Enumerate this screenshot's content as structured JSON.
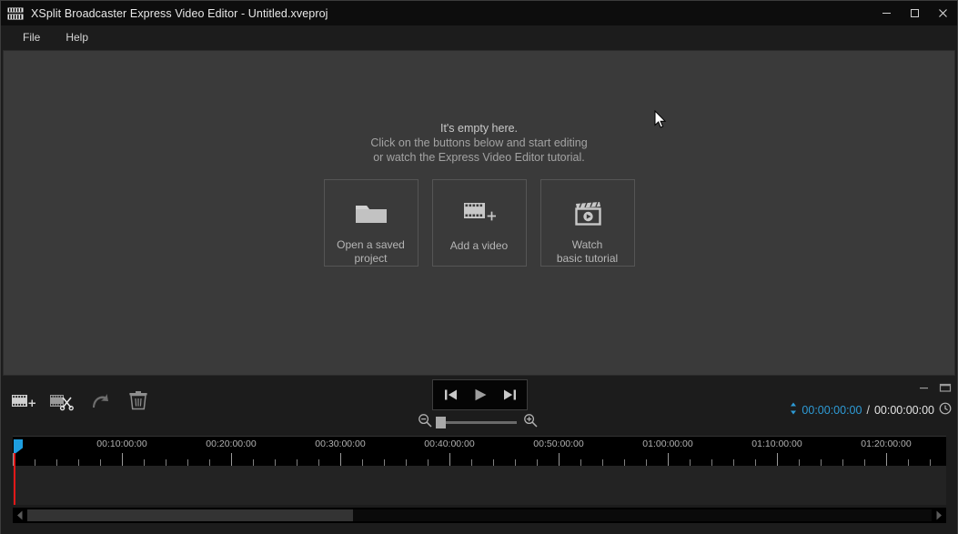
{
  "window": {
    "title": "XSplit Broadcaster Express Video Editor - Untitled.xveproj",
    "app_icon": "clapperboard-icon",
    "controls": [
      {
        "name": "minimize-button",
        "glyph": "minimize-icon"
      },
      {
        "name": "maximize-button",
        "glyph": "maximize-icon"
      },
      {
        "name": "close-button",
        "glyph": "close-icon"
      }
    ]
  },
  "menubar": {
    "items": [
      {
        "label": "File"
      },
      {
        "label": "Help"
      }
    ]
  },
  "preview": {
    "empty_state": {
      "line1": "It's empty here.",
      "line2": "Click on the buttons below and start editing",
      "line3": "or watch the Express Video Editor tutorial."
    },
    "actions": [
      {
        "label": "Open a saved\nproject",
        "icon": "folder-icon",
        "name": "open-saved-project-button"
      },
      {
        "label": "Add a video",
        "icon": "film-plus-icon",
        "name": "add-a-video-button"
      },
      {
        "label": "Watch\nbasic tutorial",
        "icon": "clapperboard-play-icon",
        "name": "watch-basic-tutorial-button"
      }
    ]
  },
  "toolbar": {
    "buttons": [
      {
        "name": "add-media-button",
        "icon": "film-plus-icon"
      },
      {
        "name": "split-clip-button",
        "icon": "film-scissors-icon"
      },
      {
        "name": "undo-button",
        "icon": "undo-arrow-icon"
      },
      {
        "name": "delete-button",
        "icon": "trash-icon"
      }
    ]
  },
  "transport": {
    "buttons": [
      {
        "name": "previous-frame-button",
        "icon": "skip-previous-icon"
      },
      {
        "name": "play-button",
        "icon": "play-icon"
      },
      {
        "name": "next-frame-button",
        "icon": "skip-next-icon"
      }
    ]
  },
  "zoom": {
    "out_icon": "zoom-out-icon",
    "in_icon": "zoom-in-icon",
    "value": 0
  },
  "panel": {
    "collapse_icon": "collapse-panel-icon",
    "expand_icon": "expand-panel-icon"
  },
  "timecode": {
    "updown_icon": "up-down-arrows-icon",
    "current": "00:00:00:00",
    "separator": "/",
    "total": "00:00:00:00",
    "clock_icon": "clock-icon",
    "current_color": "#2e9bd6"
  },
  "timeline": {
    "labels": [
      "00:10:00:00",
      "00:20:00:00",
      "00:30:00:00",
      "00:40:00:00",
      "00:50:00:00",
      "01:00:00:00",
      "01:10:00:00",
      "01:20:00:00"
    ],
    "label_interval_minutes": 10,
    "major_tick_count": 9,
    "minor_per_major": 5,
    "playhead_position": "00:00:00:00",
    "playhead_color": "#1e9ee0",
    "playhead_line_color": "#e01818"
  },
  "scrollbar": {
    "left_arrow_icon": "scroll-left-arrow-icon",
    "right_arrow_icon": "scroll-right-arrow-icon",
    "thumb_fraction": 0.36
  }
}
